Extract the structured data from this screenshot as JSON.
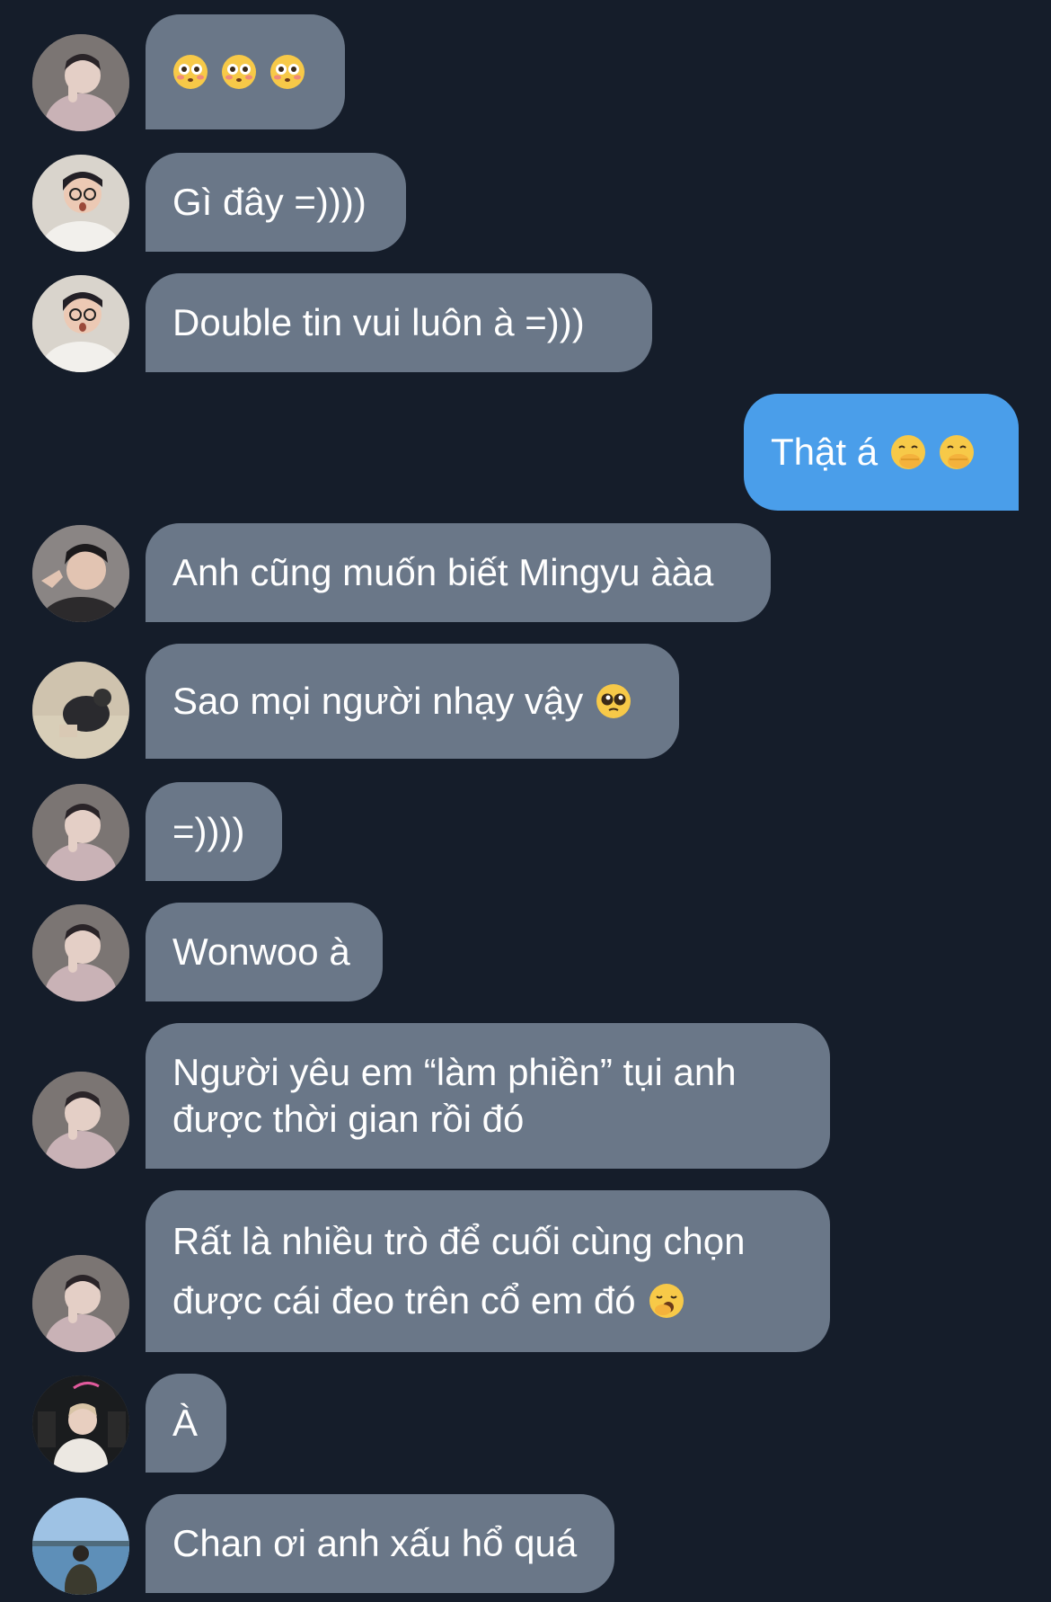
{
  "messages": [
    {
      "from": "pink-hoodie",
      "text": "😳 😳 😳",
      "emoji_only": true
    },
    {
      "from": "glasses",
      "text": "Gì đây =))))"
    },
    {
      "from": "glasses",
      "text": "Double tin vui luôn à =)))"
    },
    {
      "from": "me",
      "text": "Thật á 🫢 🫢"
    },
    {
      "from": "hand",
      "text": "Anh cũng muốn biết Mingyu ààa"
    },
    {
      "from": "crouch",
      "text": "Sao mọi người nhạy vậy 🥹"
    },
    {
      "from": "pink-hoodie",
      "text": "=))))"
    },
    {
      "from": "pink-hoodie",
      "text": "Wonwoo à"
    },
    {
      "from": "pink-hoodie",
      "text_lines": [
        "Người yêu em “làm phiền” tụi anh",
        "được thời gian rồi đó"
      ]
    },
    {
      "from": "pink-hoodie",
      "text_lines": [
        "Rất là nhiều trò để cuối cùng chọn",
        "được cái đeo trên cổ em đó 🥱"
      ]
    },
    {
      "from": "night",
      "text": "À"
    },
    {
      "from": "beach",
      "text": "Chan ơi anh xấu hổ quá"
    }
  ],
  "emojis": {
    "flushed": "flushed-face-icon",
    "hand_over_mouth": "hand-over-mouth-icon",
    "pleading": "pleading-face-icon",
    "yawning": "yawning-face-icon"
  },
  "colors": {
    "background": "#151d2a",
    "incoming_bubble": "#6a7788",
    "outgoing_bubble": "#4a9eea",
    "text": "#ffffff"
  }
}
